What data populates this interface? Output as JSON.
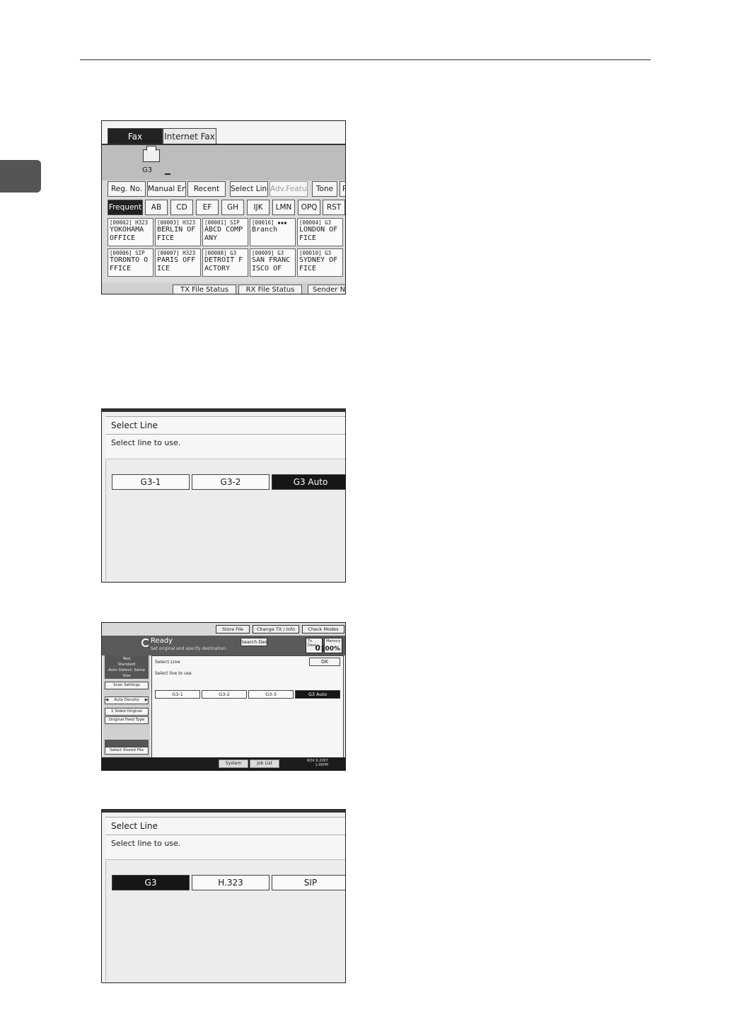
{
  "fax_main": {
    "tabs": [
      "Fax",
      "Internet Fax"
    ],
    "line_label": "G3",
    "toolbar": [
      "Reg. No.",
      "Manual Entry",
      "Recent",
      "Select Line",
      "Adv.Features",
      "Tone",
      "P"
    ],
    "index_tabs": [
      "Frequent",
      "AB",
      "CD",
      "EF",
      "GH",
      "IJK",
      "LMN",
      "OPQ",
      "RST"
    ],
    "destinations": [
      {
        "code": "[00002] H323",
        "name": "YOKOHAMA OFFICE"
      },
      {
        "code": "[00003] H323",
        "name": "BERLIN OFFICE"
      },
      {
        "code": "[00001] SIP",
        "name": "ABCD COMPANY"
      },
      {
        "code": "[00016] ▪▪▪",
        "name": "Branch"
      },
      {
        "code": "[00004] G3",
        "name": "LONDON OFFICE"
      },
      {
        "code": "[00006] SIP",
        "name": "TORONTO OFFICE"
      },
      {
        "code": "[00007] H323",
        "name": "PARIS OFFICE"
      },
      {
        "code": "[00008] G3",
        "name": "DETROIT FACTORY"
      },
      {
        "code": "[00009] G3",
        "name": "SAN FRANCISCO OF"
      },
      {
        "code": "[00010] G3",
        "name": "SYDNEY OFFICE"
      }
    ],
    "bottom_tabs": [
      "TX File Status",
      "RX File Status",
      "Sender N"
    ]
  },
  "dialog_a": {
    "title": "Select Line",
    "message": "Select line to use.",
    "lines": [
      "G3-1",
      "G3-2",
      "G3 Auto"
    ],
    "selected": 2
  },
  "full_screen": {
    "top_buttons": [
      "Store File",
      "Change TX / Info",
      "Check Modes"
    ],
    "status": "Ready",
    "status_sub": "Set original and specify destination.",
    "search_dest": "Search Dest.",
    "tx_dest_label": "Tx. Dest",
    "tx_dest_value": "0",
    "memory_label": "Memory",
    "memory_value": "100%",
    "settings_lines": [
      "Text",
      "Standard",
      "Auto Detect: Same Size"
    ],
    "scan_settings": "Scan Settings",
    "auto_density": "Auto Density",
    "sided_original": "1 Sided Original",
    "original_feed_type": "Original Feed Type",
    "select_stored_file": "Select Stored File",
    "panel_title": "Select Line",
    "panel_message": "Select line to use.",
    "ok": "OK",
    "lines": [
      "G3-1",
      "G3-2",
      "G3-3",
      "G3 Auto"
    ],
    "selected": 3,
    "footer_buttons": [
      "System Status",
      "Job List"
    ],
    "date": "NOV   6,2007",
    "time": "1:46PM"
  },
  "dialog_b": {
    "title": "Select Line",
    "message": "Select line to use.",
    "lines": [
      "G3",
      "H.323",
      "SIP"
    ],
    "selected": 0
  }
}
